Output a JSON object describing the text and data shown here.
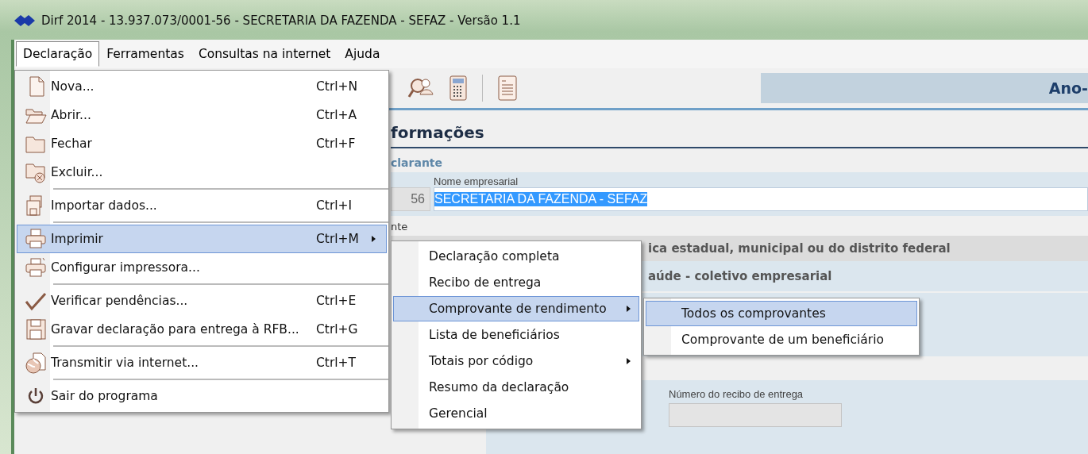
{
  "window": {
    "title": "Dirf 2014 - 13.937.073/0001-56 - SECRETARIA DA FAZENDA - SEFAZ - Versão 1.1"
  },
  "menubar": [
    {
      "label": "Declaração",
      "selected": true
    },
    {
      "label": "Ferramentas",
      "selected": false
    },
    {
      "label": "Consultas na internet",
      "selected": false
    },
    {
      "label": "Ajuda",
      "selected": false
    }
  ],
  "banner": {
    "text": "Ano-"
  },
  "form": {
    "heading": "formações",
    "section": "clarante",
    "name_label": "Nome empresarial",
    "id_fragment": "56",
    "name_value": "SECRETARIA DA FAZENDA - SEFAZ",
    "label_fragment": "nte",
    "type_fragment": "ica estadual, municipal ou do distrito federal",
    "plan_fragment": "aúde - coletivo empresarial",
    "receipt_label": "Número do recibo de entrega"
  },
  "menu": [
    {
      "kind": "item",
      "label": "Nova...",
      "shortcut": "Ctrl+N",
      "selected": false,
      "submenu": false
    },
    {
      "kind": "item",
      "label": "Abrir...",
      "shortcut": "Ctrl+A",
      "selected": false,
      "submenu": false
    },
    {
      "kind": "item",
      "label": "Fechar",
      "shortcut": "Ctrl+F",
      "selected": false,
      "submenu": false
    },
    {
      "kind": "item",
      "label": "Excluir...",
      "selected": false,
      "submenu": false
    },
    {
      "kind": "separator"
    },
    {
      "kind": "item",
      "label": "Importar dados...",
      "shortcut": "Ctrl+I",
      "selected": false,
      "submenu": false
    },
    {
      "kind": "separator"
    },
    {
      "kind": "item",
      "label": "Imprimir",
      "shortcut": "Ctrl+M",
      "selected": true,
      "submenu": true
    },
    {
      "kind": "item",
      "label": "Configurar impressora...",
      "selected": false,
      "submenu": false
    },
    {
      "kind": "separator"
    },
    {
      "kind": "item",
      "label": "Verificar pendências...",
      "shortcut": "Ctrl+E",
      "selected": false,
      "submenu": false
    },
    {
      "kind": "item",
      "label": "Gravar declaração para entrega à RFB...",
      "shortcut": "Ctrl+G",
      "selected": false,
      "submenu": false
    },
    {
      "kind": "separator"
    },
    {
      "kind": "item",
      "label": "Transmitir via internet...",
      "shortcut": "Ctrl+T",
      "selected": false,
      "submenu": false
    },
    {
      "kind": "separator"
    },
    {
      "kind": "item",
      "label": "Sair do programa",
      "selected": false,
      "submenu": false
    }
  ],
  "print_submenu": [
    {
      "label": "Declaração completa",
      "selected": false,
      "submenu": false
    },
    {
      "label": "Recibo de entrega",
      "selected": false,
      "submenu": false
    },
    {
      "label": "Comprovante de rendimento",
      "selected": true,
      "submenu": true
    },
    {
      "label": "Lista de beneficiários",
      "selected": false,
      "submenu": false
    },
    {
      "label": "Totais por código",
      "selected": false,
      "submenu": true
    },
    {
      "label": "Resumo da declaração",
      "selected": false,
      "submenu": false
    },
    {
      "label": "Gerencial",
      "selected": false,
      "submenu": false
    }
  ],
  "receipt_submenu": [
    {
      "label": "Todos os comprovantes",
      "selected": true
    },
    {
      "label": "Comprovante de um beneficiário",
      "selected": false
    }
  ]
}
